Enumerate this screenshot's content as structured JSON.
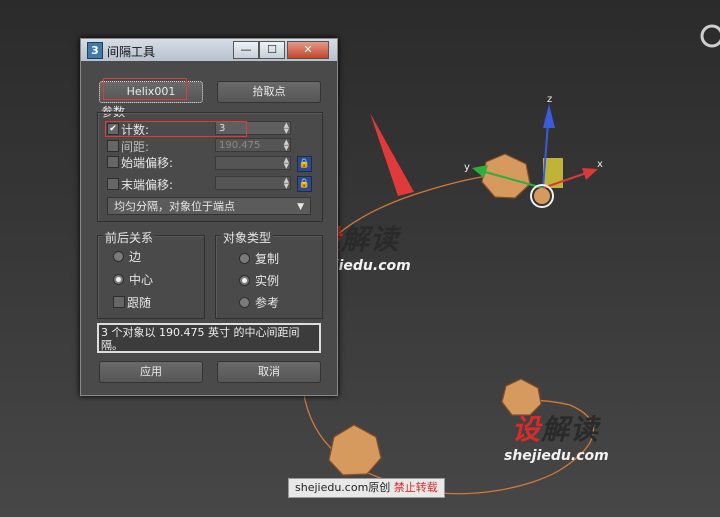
{
  "dialog": {
    "app_icon": "3",
    "title": "间隔工具",
    "minimize_glyph": "—",
    "maximize_glyph": "☐",
    "close_glyph": "✕",
    "pick_path_label": "Helix001",
    "pick_points_label": "拾取点",
    "params_label": "参数",
    "count": {
      "label": "计数:",
      "value": "3",
      "checked_glyph": "✔"
    },
    "spacing": {
      "label": "间距:",
      "value": "190.475"
    },
    "start_offset": {
      "label": "始端偏移:",
      "value": ""
    },
    "end_offset": {
      "label": "末端偏移:",
      "value": ""
    },
    "distribution": "均匀分隔，对象位于端点",
    "context_group": {
      "label": "前后关系",
      "options": [
        "边",
        "中心"
      ],
      "selected": "中心",
      "follow_label": "跟随"
    },
    "object_type_group": {
      "label": "对象类型",
      "options": [
        "复制",
        "实例",
        "参考"
      ],
      "selected": "实例"
    },
    "status": "3 个对象以 190.475 英寸 的中心间距间隔。",
    "apply_label": "应用",
    "cancel_label": "取消"
  },
  "viewport": {
    "axis_labels": {
      "z": "z",
      "x": "x",
      "y": "y"
    },
    "watermark_cn_red": "设",
    "watermark_cn_rest": "解读",
    "watermark_url": "shejiedu.com",
    "credit": {
      "site": "shejiedu.com原创",
      "note": "禁止转载"
    }
  },
  "colors": {
    "path": "#d07a3c",
    "highlight": "#e03a3a",
    "object": "#d79a5e"
  }
}
